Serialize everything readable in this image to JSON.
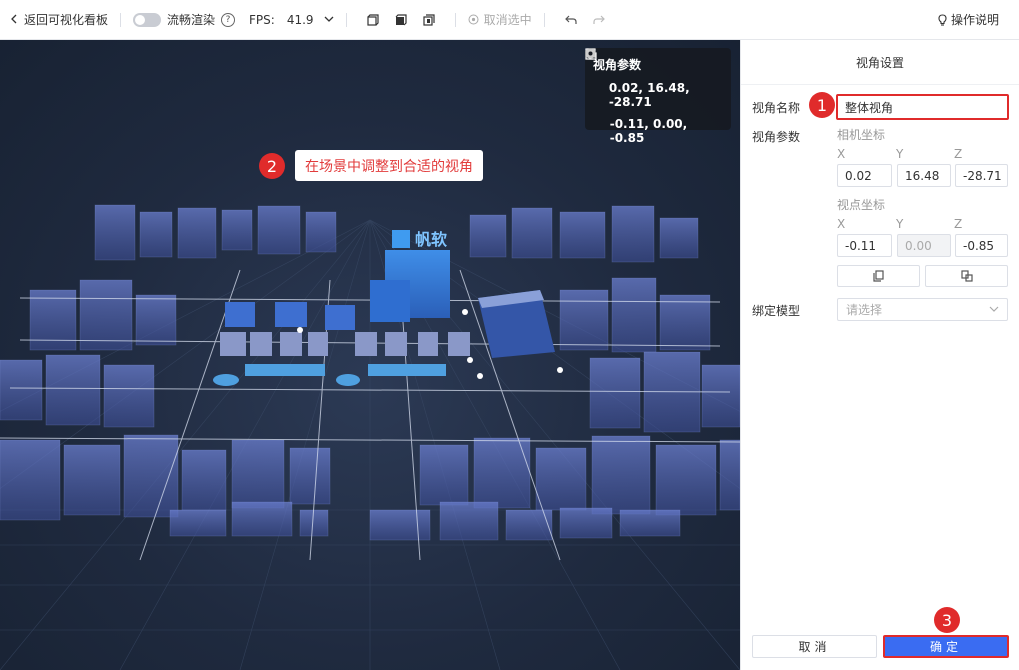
{
  "toolbar": {
    "back_label": "返回可视化看板",
    "smooth_label": "流畅渲染",
    "help_glyph": "?",
    "fps_label": "FPS:",
    "fps_value": "41.9",
    "deselect_label": "取消选中",
    "guide_label": "操作说明"
  },
  "viewport": {
    "param_card": {
      "title": "视角参数",
      "camera_value": "0.02, 16.48, -28.71",
      "target_value": "-0.11, 0.00, -0.85"
    },
    "hint_text": "在场景中调整到合适的视角",
    "logo_text": "帆软"
  },
  "badges": {
    "one": "1",
    "two": "2",
    "three": "3"
  },
  "panel": {
    "title": "视角设置",
    "name_label": "视角名称",
    "name_value": "整体视角",
    "params_label": "视角参数",
    "camera_label": "相机坐标",
    "target_label": "视点坐标",
    "axis_x": "X",
    "axis_y": "Y",
    "axis_z": "Z",
    "camera": {
      "x": "0.02",
      "y": "16.48",
      "z": "-28.71"
    },
    "target": {
      "x": "-0.11",
      "y": "0.00",
      "z": "-0.85"
    },
    "bind_label": "绑定模型",
    "bind_placeholder": "请选择",
    "cancel_label": "取消",
    "ok_label": "确定"
  },
  "colors": {
    "accent": "#3a6cf2",
    "annotation": "#e02b2b",
    "scene_bg": "#1f2a3f",
    "building": "#4a5ea8"
  }
}
